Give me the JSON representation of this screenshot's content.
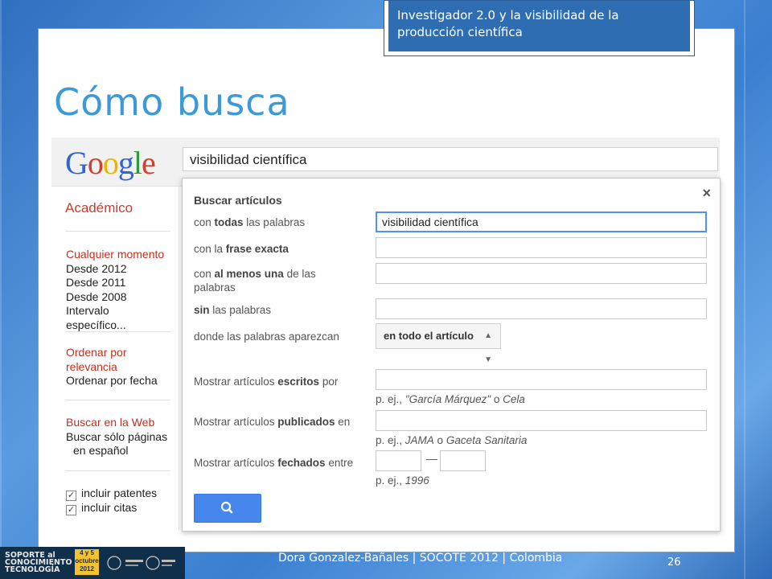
{
  "header": {
    "banner_text": "Investigador 2.0 y la visibilidad de la producción científica",
    "title": "Cómo busca"
  },
  "google_bar": {
    "logo_letters": [
      {
        "char": "G",
        "color": "#3366cc"
      },
      {
        "char": "o",
        "color": "#d23f31"
      },
      {
        "char": "o",
        "color": "#f0b400"
      },
      {
        "char": "g",
        "color": "#3366cc"
      },
      {
        "char": "l",
        "color": "#2c9c3c"
      },
      {
        "char": "e",
        "color": "#d23f31"
      }
    ],
    "search_value": "visibilidad científica"
  },
  "sidebar": {
    "section_title": "Académico",
    "time_filters": {
      "active": "Cualquier momento",
      "items": [
        "Desde 2012",
        "Desde 2011",
        "Desde 2008",
        "Intervalo específico..."
      ]
    },
    "sort": {
      "active_line1": "Ordenar por",
      "active_line2": "relevancia",
      "other": "Ordenar por fecha"
    },
    "web": {
      "active": "Buscar en la Web",
      "other_line1": "Buscar sólo páginas",
      "other_line2": "en español"
    },
    "checkboxes": [
      "incluir patentes",
      "incluir citas"
    ]
  },
  "dialog": {
    "title": "Buscar artículos",
    "close_glyph": "×",
    "rows": {
      "all_words": {
        "pre": "con ",
        "bold": "todas",
        "post": " las palabras",
        "value": "visibilidad científica"
      },
      "exact": {
        "pre": "con la ",
        "bold": "frase exacta",
        "post": ""
      },
      "any_line1_pre": "con ",
      "any_bold": "al menos una",
      "any_line1_post": " de las",
      "any_line2": "palabras",
      "without": {
        "pre": "",
        "bold": "sin",
        "post": " las palabras"
      },
      "where": "donde las palabras aparezcan",
      "where_value": "en todo el artículo",
      "author": {
        "pre": "Mostrar artículos ",
        "bold": "escritos",
        "post": " por"
      },
      "author_hint_pre": "p. ej., ",
      "author_hint_em1": "\"García Márquez\"",
      "author_hint_mid": " o ",
      "author_hint_em2": "Cela",
      "pub": {
        "pre": "Mostrar artículos ",
        "bold": "publicados",
        "post": " en"
      },
      "pub_hint_pre": "p. ej., ",
      "pub_hint_em1": "JAMA",
      "pub_hint_mid": " o ",
      "pub_hint_em2": "Gaceta Sanitaria",
      "date": {
        "pre": "Mostrar artículos ",
        "bold": "fechados",
        "post": " entre"
      },
      "date_sep": "—",
      "date_hint_pre": "p. ej., ",
      "date_hint_em": "1996"
    }
  },
  "footer": {
    "logo_line1": "SOPORTE al",
    "logo_line2": "CONOCIMIENTO",
    "logo_line3": "TECNOLOGÍA",
    "logo_badge_1": "4 y 5",
    "logo_badge_2": "octubre",
    "logo_badge_3": "2012",
    "credit": "Dora Gonzalez-Bañales | SOCOTE 2012 | Colombia",
    "page_number": "26"
  }
}
